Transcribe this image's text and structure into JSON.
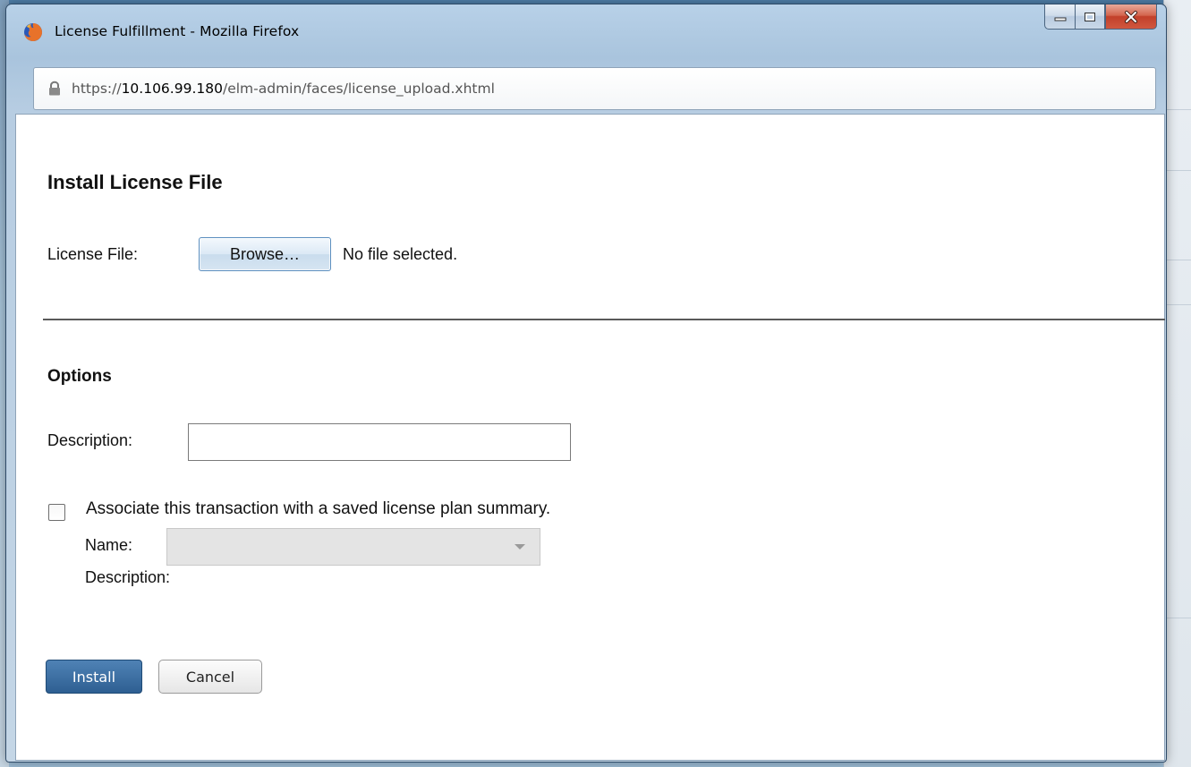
{
  "window": {
    "title": "License Fulfillment - Mozilla Firefox",
    "controls": {
      "minimize_icon": "minimize-icon",
      "maximize_icon": "maximize-icon",
      "close_icon": "close-icon"
    }
  },
  "address_bar": {
    "scheme": "https://",
    "host": "10.106.99.180",
    "path": "/elm-admin/faces/license_upload.xhtml",
    "lock_icon": "lock-icon"
  },
  "form": {
    "heading": "Install License File",
    "license_file_label": "License File:",
    "browse_label": "Browse…",
    "file_status": "No file selected.",
    "options_heading": "Options",
    "description_label": "Description:",
    "description_value": "",
    "associate_checkbox_checked": false,
    "associate_label": "Associate this transaction with a saved license plan summary.",
    "plan_name_label": "Name:",
    "plan_name_value": "",
    "plan_description_label": "Description:",
    "install_label": "Install",
    "cancel_label": "Cancel"
  },
  "colors": {
    "install_button": "#2e5f92",
    "title_bar": "#b8d1e8",
    "close_button": "#c2402a"
  }
}
